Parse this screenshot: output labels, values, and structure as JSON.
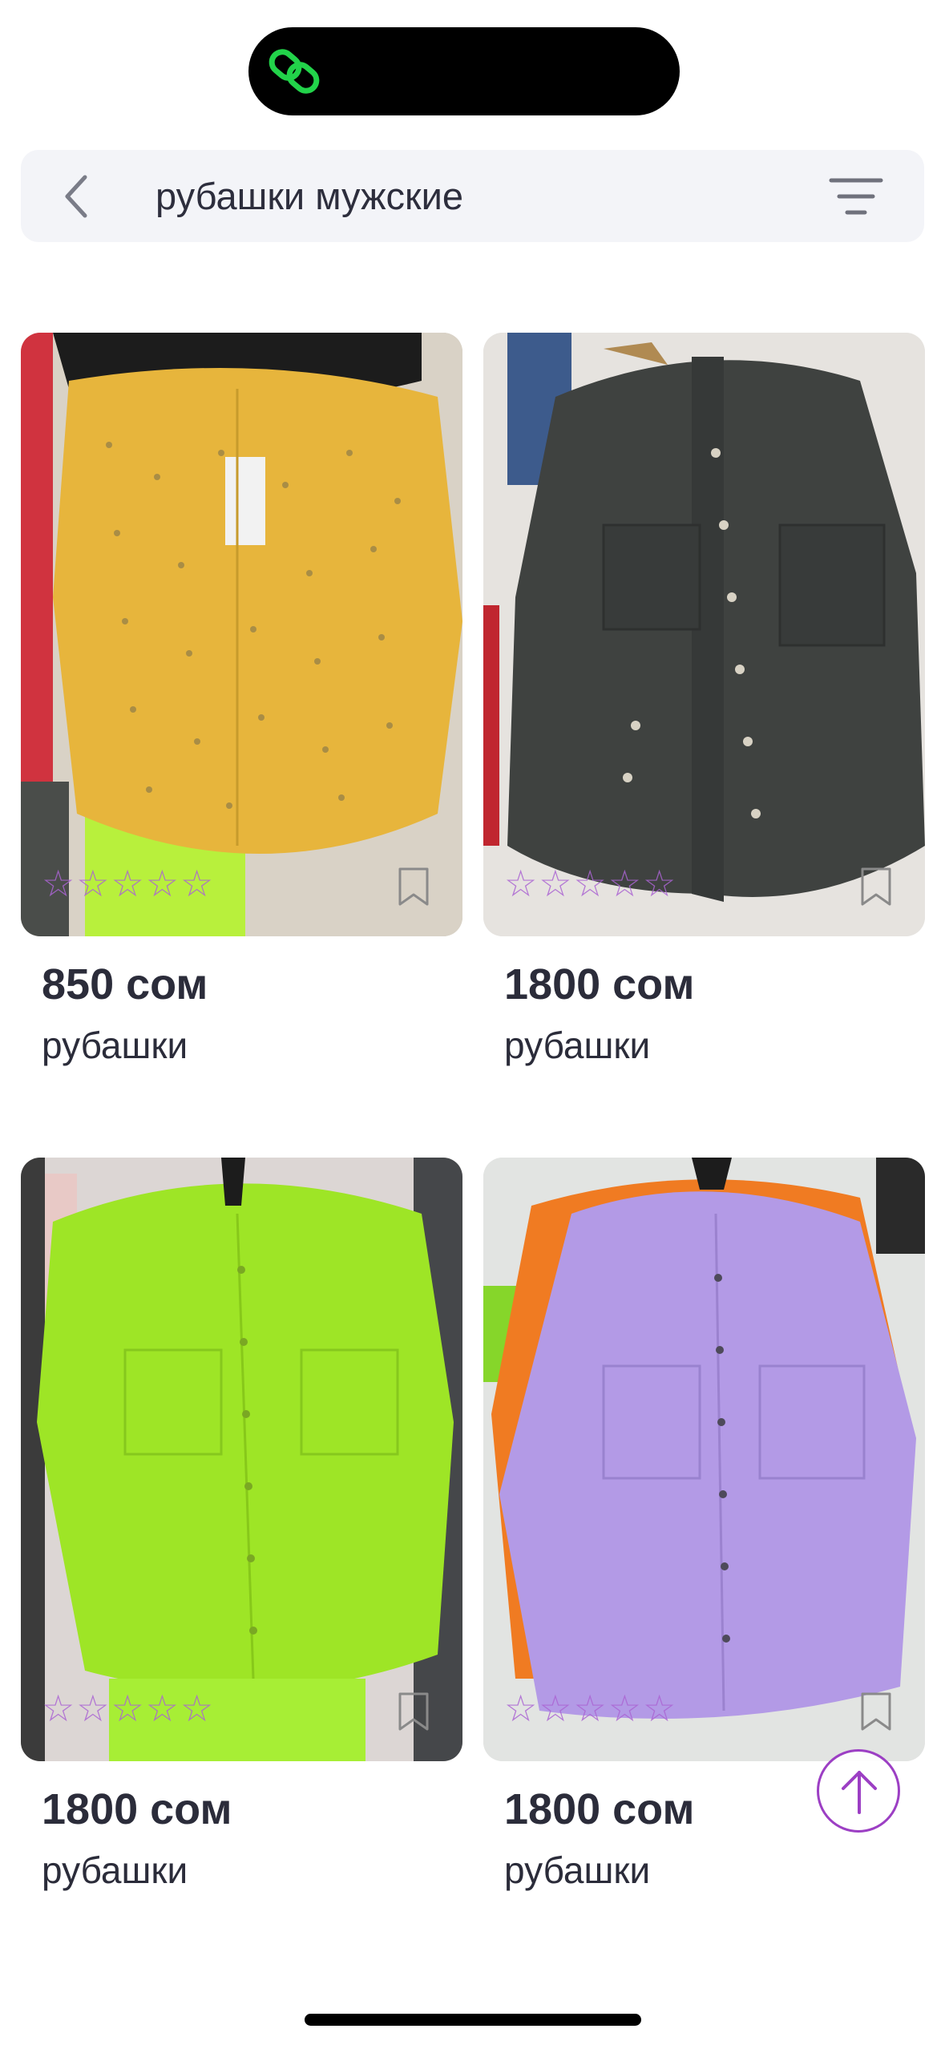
{
  "search": {
    "query": "рубашки мужские"
  },
  "icons": {
    "status_logo": "chain-link-icon",
    "back": "chevron-left-icon",
    "filter": "filter-lines-icon",
    "favorite": "bookmark-icon",
    "rating": "star-outline-icon",
    "scroll_top": "arrow-up-icon"
  },
  "colors": {
    "accent": "#9c3fc4",
    "status_logo": "#22d34a",
    "search_bg": "#f3f4f8"
  },
  "products": [
    {
      "price": "850 сом",
      "name": "рубашки",
      "rating": 0,
      "rating_max": 5,
      "stars": "☆☆☆☆☆",
      "shirt_color": "#e7b53c"
    },
    {
      "price": "1800 сом",
      "name": "рубашки",
      "rating": 0,
      "rating_max": 5,
      "stars": "☆☆☆☆☆",
      "shirt_color": "#3f4240"
    },
    {
      "price": "1800 сом",
      "name": "рубашки",
      "rating": 0,
      "rating_max": 5,
      "stars": "☆☆☆☆☆",
      "shirt_color": "#9ee526"
    },
    {
      "price": "1800 сом",
      "name": "рубашки",
      "rating": 0,
      "rating_max": 5,
      "stars": "☆☆☆☆☆",
      "shirt_color": "#b39ae6"
    }
  ]
}
